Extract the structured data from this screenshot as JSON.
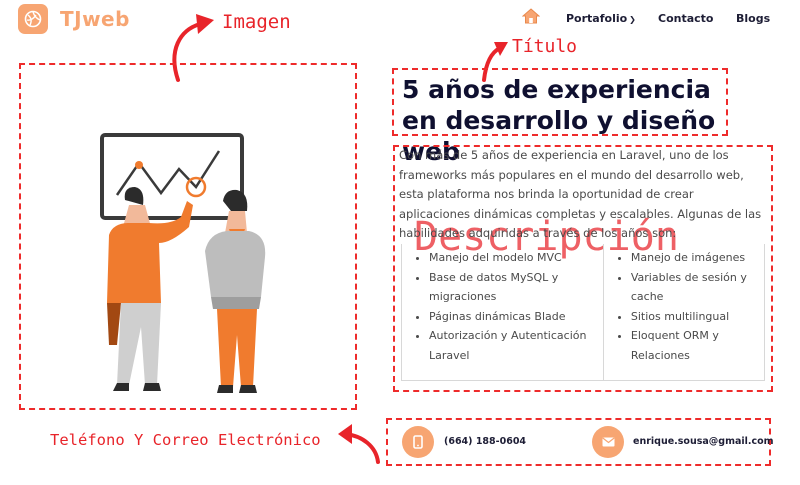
{
  "brand": {
    "name": "TJweb",
    "logo_icon": "logo-globe-icon",
    "accent": "#f7a572"
  },
  "nav": {
    "home_icon": "home-icon",
    "items": [
      {
        "label": "Portafolio",
        "has_dropdown": true
      },
      {
        "label": "Contacto"
      },
      {
        "label": "Blogs"
      }
    ]
  },
  "annotations": {
    "image": "Imagen",
    "title": "Título",
    "description": "Descripción",
    "contact": "Teléfono Y Correo Electrónico",
    "color": "#e8242a"
  },
  "hero": {
    "title": "5 años de experiencia en desarrollo y diseño web",
    "description": "Con más de 5 años de experiencia en Laravel, uno de los frameworks más populares en el mundo del desarrollo web, esta plataforma nos brinda la oportunidad de crear aplicaciones dinámicas completas y escalables. Algunas de las habilidades adquiridas a través de los años son:",
    "skills_left": [
      "Manejo del modelo MVC",
      "Base de datos MySQL y migraciones",
      "Páginas dinámicas Blade",
      "Autorización y Autenticación Laravel"
    ],
    "skills_right": [
      "Manejo de imágenes",
      "Variables de sesión y cache",
      "Sitios multilingual",
      "Eloquent ORM y Relaciones"
    ]
  },
  "contact": {
    "phone": "(664) 188-0604",
    "email": "enrique.sousa@gmail.com",
    "phone_icon": "phone-icon",
    "email_icon": "envelope-icon"
  }
}
